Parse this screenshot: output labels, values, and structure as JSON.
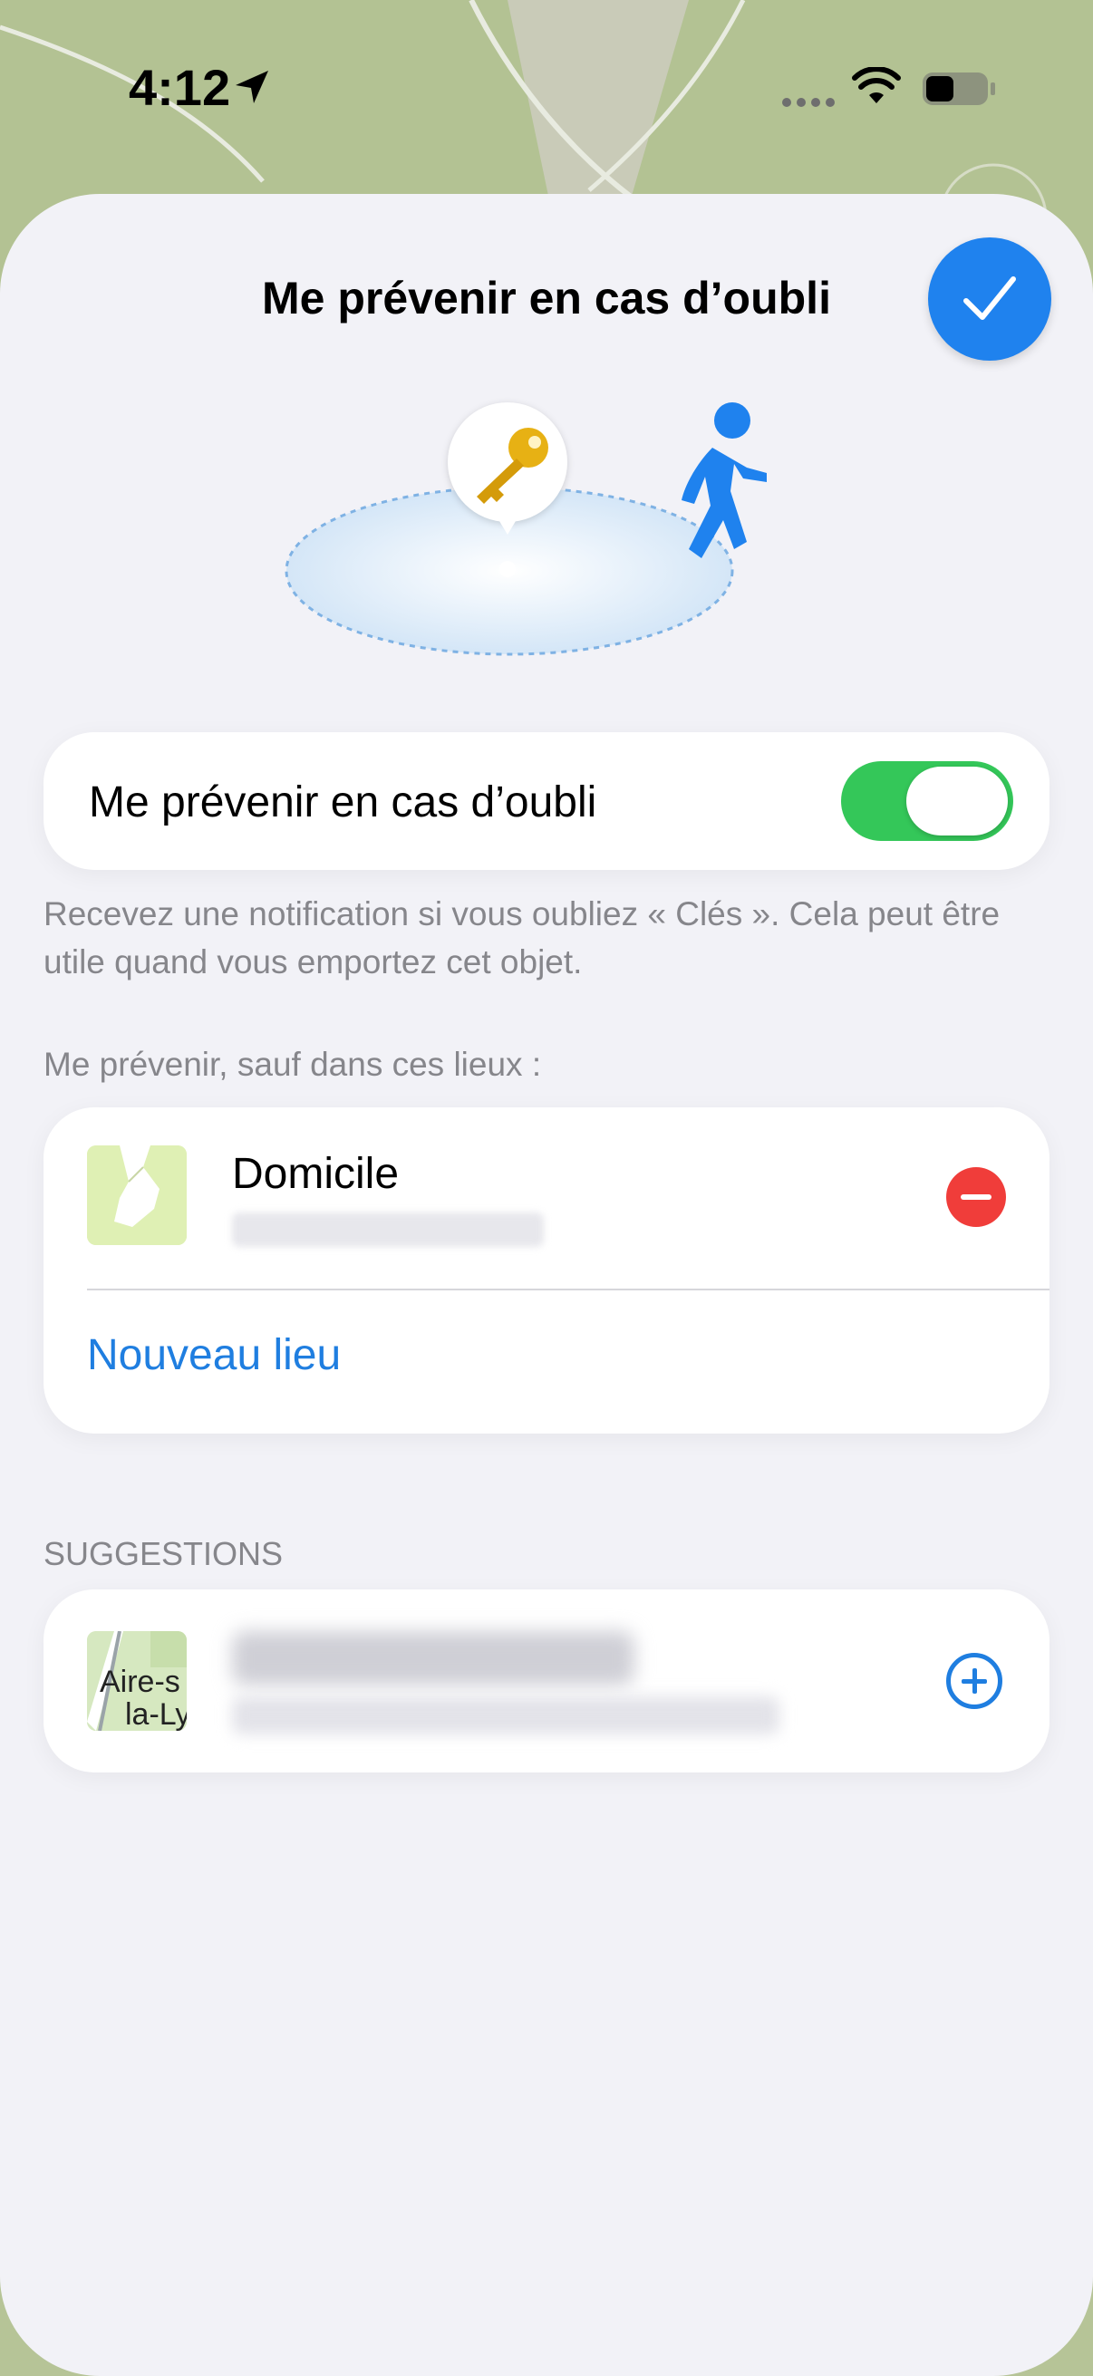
{
  "status_bar": {
    "time": "4:12"
  },
  "sheet": {
    "title": "Me prévenir en cas d’oubli"
  },
  "illustration": {
    "item_icon": "key-icon",
    "person_icon": "walking-person-icon"
  },
  "alert_toggle": {
    "label": "Me prévenir en cas d’oubli",
    "on": true,
    "footer": "Recevez une notification si vous oubliez « Clés ». Cela peut être utile quand vous emportez cet objet."
  },
  "places": {
    "header": "Me prévenir, sauf dans ces lieux :",
    "items": [
      {
        "name": "Domicile",
        "address": ""
      }
    ],
    "new_place_label": "Nouveau lieu"
  },
  "suggestions": {
    "header": "SUGGESTIONS",
    "items": [
      {
        "map_label_line1": "Aire-s",
        "map_label_line2": "la-Ly"
      }
    ]
  },
  "colors": {
    "accent": "#1f82ee",
    "toggle_on": "#34c759",
    "destructive": "#f03d3a",
    "sheet_background": "#f2f2f7"
  }
}
